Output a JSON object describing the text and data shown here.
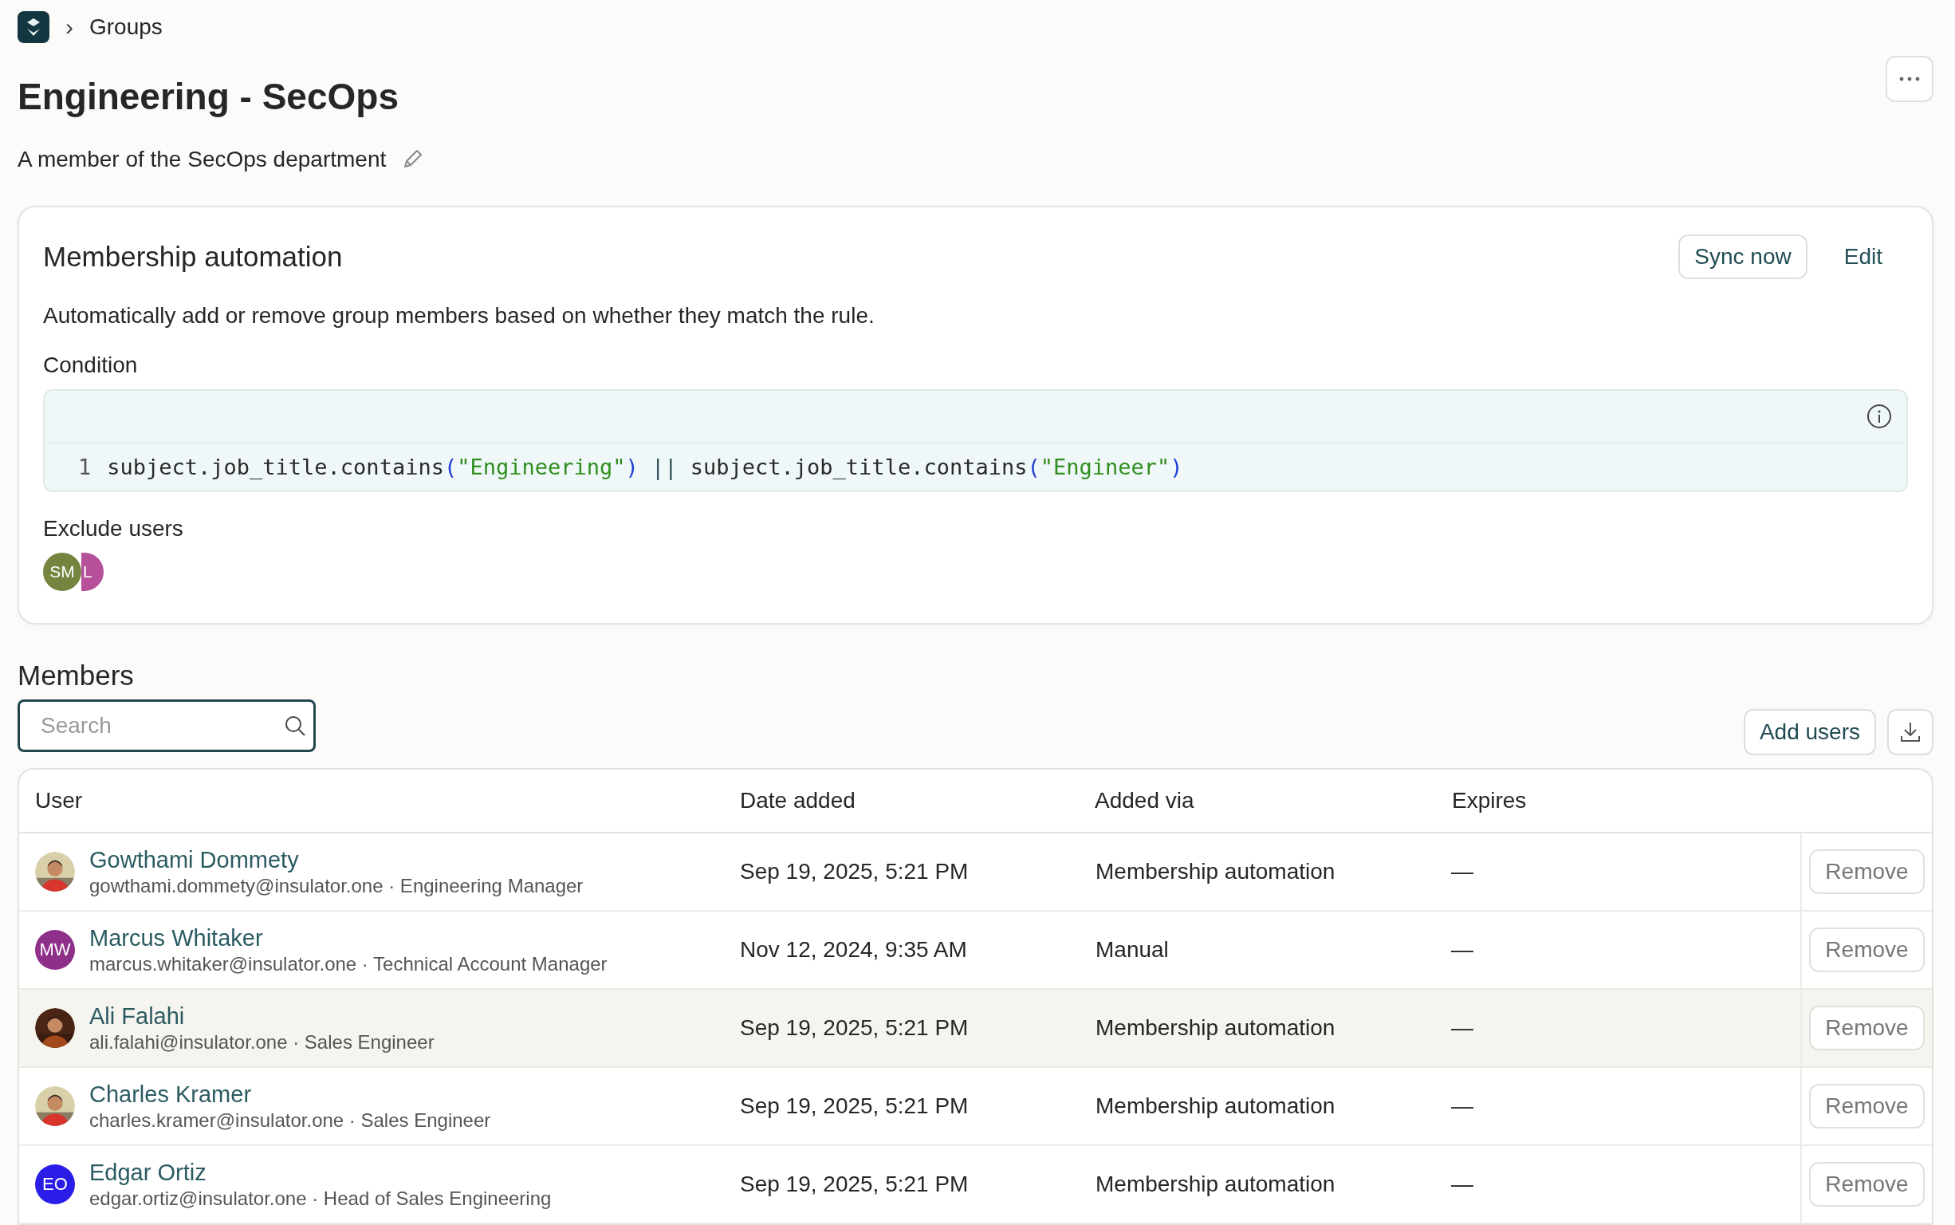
{
  "breadcrumb": {
    "separator": "›",
    "current": "Groups"
  },
  "title": "Engineering - SecOps",
  "description": "A member of the SecOps department",
  "automation": {
    "title": "Membership automation",
    "buttons": [
      "Sync now",
      "Edit"
    ],
    "description": "Automatically add or remove group members based on whether they match the rule.",
    "condition_label": "Condition",
    "lines": [
      {
        "number": "1",
        "tokens": [
          {
            "text": "subject.job_title.contains",
            "kind": "plain"
          },
          {
            "text": "(",
            "kind": "punct"
          },
          {
            "text": "\"Engineering\"",
            "kind": "string"
          },
          {
            "text": ")",
            "kind": "punct"
          },
          {
            "text": " || ",
            "kind": "operator"
          },
          {
            "text": "subject.job_title.contains",
            "kind": "plain"
          },
          {
            "text": "(",
            "kind": "punct"
          },
          {
            "text": "\"Engineer\"",
            "kind": "string"
          },
          {
            "text": ")",
            "kind": "punct"
          }
        ]
      }
    ],
    "exclude_label": "Exclude users",
    "excluded": [
      {
        "initials": "SM",
        "color": "#75843f"
      },
      {
        "initials": "L",
        "color": "#b6509a"
      }
    ]
  },
  "members": {
    "title": "Members",
    "search": {
      "placeholder": "Search"
    },
    "add_button": "Add users",
    "columns": [
      "User",
      "Date added",
      "Added via",
      "Expires"
    ],
    "rows": [
      {
        "name": "Gowthami Dommety",
        "detail": "gowthami.dommety@insulator.one · Engineering Manager",
        "date": "Sep 19, 2025, 5:21 PM",
        "via": "Membership automation",
        "expires": "—",
        "action": "Remove",
        "highlighted": false
      },
      {
        "name": "Marcus Whitaker",
        "detail": "marcus.whitaker@insulator.one · Technical Account Manager",
        "avatar": {
          "kind": "initials",
          "initials": "MW",
          "color": "#8e2f8a"
        },
        "date": "Nov 12, 2024, 9:35 AM",
        "via": "Manual",
        "expires": "—",
        "action": "Remove",
        "highlighted": false
      },
      {
        "name": "Ali Falahi",
        "detail": "ali.falahi@insulator.one · Sales Engineer",
        "date": "Sep 19, 2025, 5:21 PM",
        "via": "Membership automation",
        "expires": "—",
        "action": "Remove",
        "highlighted": true
      },
      {
        "name": "Charles Kramer",
        "detail": "charles.kramer@insulator.one · Sales Engineer",
        "date": "Sep 19, 2025, 5:21 PM",
        "via": "Membership automation",
        "expires": "—",
        "action": "Remove",
        "highlighted": false
      },
      {
        "name": "Edgar Ortiz",
        "detail": "edgar.ortiz@insulator.one · Head of Sales Engineering",
        "avatar": {
          "kind": "initials",
          "initials": "EO",
          "color": "#2b1de8"
        },
        "date": "Sep 19, 2025, 5:21 PM",
        "via": "Membership automation",
        "expires": "—",
        "action": "Remove",
        "highlighted": false
      }
    ]
  }
}
